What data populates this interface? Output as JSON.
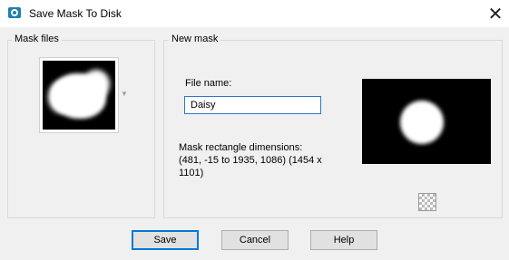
{
  "window": {
    "title": "Save Mask To Disk",
    "close_glyph": "✕",
    "app_icon": "camera-icon"
  },
  "mask_files": {
    "label": "Mask files",
    "dropdown_glyph": "▼"
  },
  "new_mask": {
    "label": "New mask",
    "file_name_label": "File name:",
    "file_name_value": "Daisy",
    "dims_label": "Mask rectangle dimensions:",
    "dims_value": "(481, -15 to 1935, 1086) (1454 x 1101)"
  },
  "buttons": {
    "save": "Save",
    "cancel": "Cancel",
    "help": "Help"
  },
  "colors": {
    "accent": "#0078d7",
    "preview_bg": "#000000"
  }
}
